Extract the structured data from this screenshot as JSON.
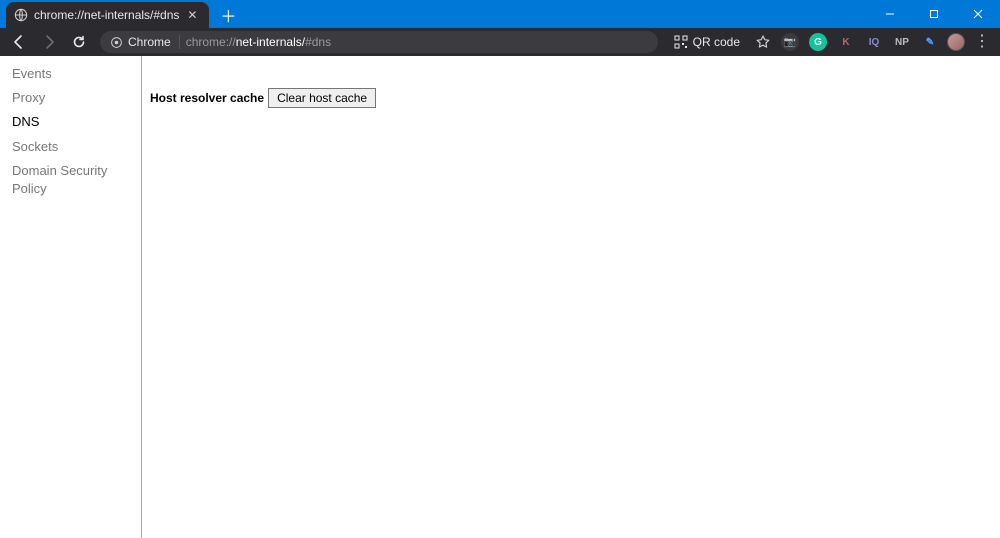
{
  "tab": {
    "title": "chrome://net-internals/#dns"
  },
  "omnibox": {
    "chip_label": "Chrome",
    "url_bold": "net-internals/",
    "url_prefix": "chrome://",
    "url_suffix": "#dns"
  },
  "qr": {
    "label": "QR code"
  },
  "extensions": [
    {
      "name": "camera-icon",
      "glyph": "📷",
      "bg": "#3a3a3e",
      "fg": "#cfcfcf"
    },
    {
      "name": "grammarly-icon",
      "glyph": "G",
      "bg": "#15c39a",
      "fg": "#fff"
    },
    {
      "name": "k-extension-icon",
      "glyph": "K",
      "bg": "transparent",
      "fg": "#b06a6a"
    },
    {
      "name": "iq-extension-icon",
      "glyph": "IQ",
      "bg": "transparent",
      "fg": "#8a8ad6"
    },
    {
      "name": "np-extension-icon",
      "glyph": "NP",
      "bg": "transparent",
      "fg": "#bdbdbd"
    },
    {
      "name": "pen-extension-icon",
      "glyph": "✎",
      "bg": "transparent",
      "fg": "#4aa3ff"
    }
  ],
  "sidebar": {
    "items": [
      {
        "label": "Events",
        "active": false
      },
      {
        "label": "Proxy",
        "active": false
      },
      {
        "label": "DNS",
        "active": true
      },
      {
        "label": "Sockets",
        "active": false
      },
      {
        "label": "Domain Security Policy",
        "active": false
      }
    ]
  },
  "main": {
    "cache_label": "Host resolver cache",
    "clear_button": "Clear host cache"
  }
}
